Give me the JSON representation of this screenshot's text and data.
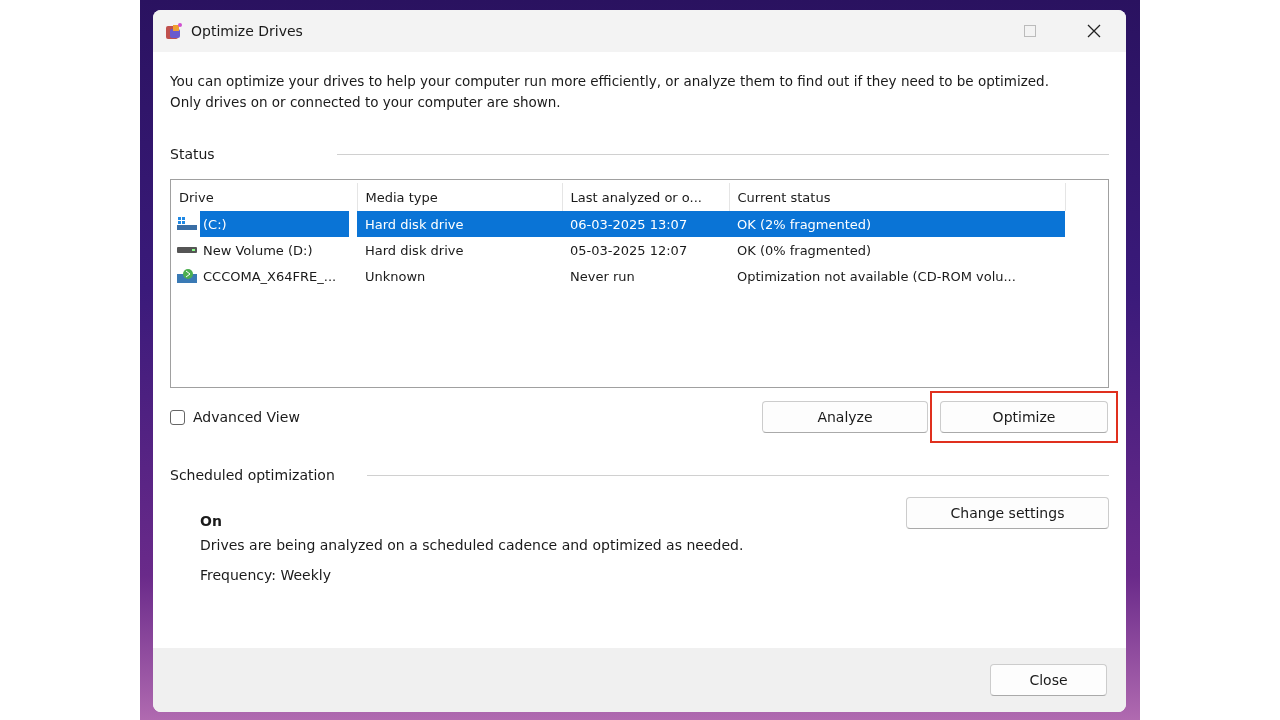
{
  "window": {
    "title": "Optimize Drives"
  },
  "description": "You can optimize your drives to help your computer run more efficiently, or analyze them to find out if they need to be optimized. Only drives on or connected to your computer are shown.",
  "status": {
    "label": "Status",
    "table": {
      "columns": [
        "Drive",
        "Media type",
        "Last analyzed or o...",
        "Current status"
      ],
      "rows": [
        {
          "kind": "system",
          "drive": "(C:)",
          "media_type": "Hard disk drive",
          "last_analyzed": "06-03-2025 13:07",
          "current_status": "OK (2% fragmented)",
          "selected": true
        },
        {
          "kind": "disk",
          "drive": "New Volume (D:)",
          "media_type": "Hard disk drive",
          "last_analyzed": "05-03-2025 12:07",
          "current_status": "OK (0% fragmented)",
          "selected": false
        },
        {
          "kind": "cdrom",
          "drive": "CCCOMA_X64FRE_...",
          "media_type": "Unknown",
          "last_analyzed": "Never run",
          "current_status": "Optimization not available (CD-ROM volu...",
          "selected": false
        }
      ]
    },
    "advanced_view": {
      "label": "Advanced View",
      "checked": false
    },
    "buttons": [
      {
        "label": "Analyze",
        "highlighted": false
      },
      {
        "label": "Optimize",
        "highlighted": true
      }
    ]
  },
  "scheduled": {
    "label": "Scheduled optimization",
    "state": "On",
    "description": "Drives are being analyzed on a scheduled cadence and optimized as needed.",
    "frequency": "Frequency: Weekly",
    "button": "Change settings"
  },
  "footer": {
    "button": "Close"
  }
}
